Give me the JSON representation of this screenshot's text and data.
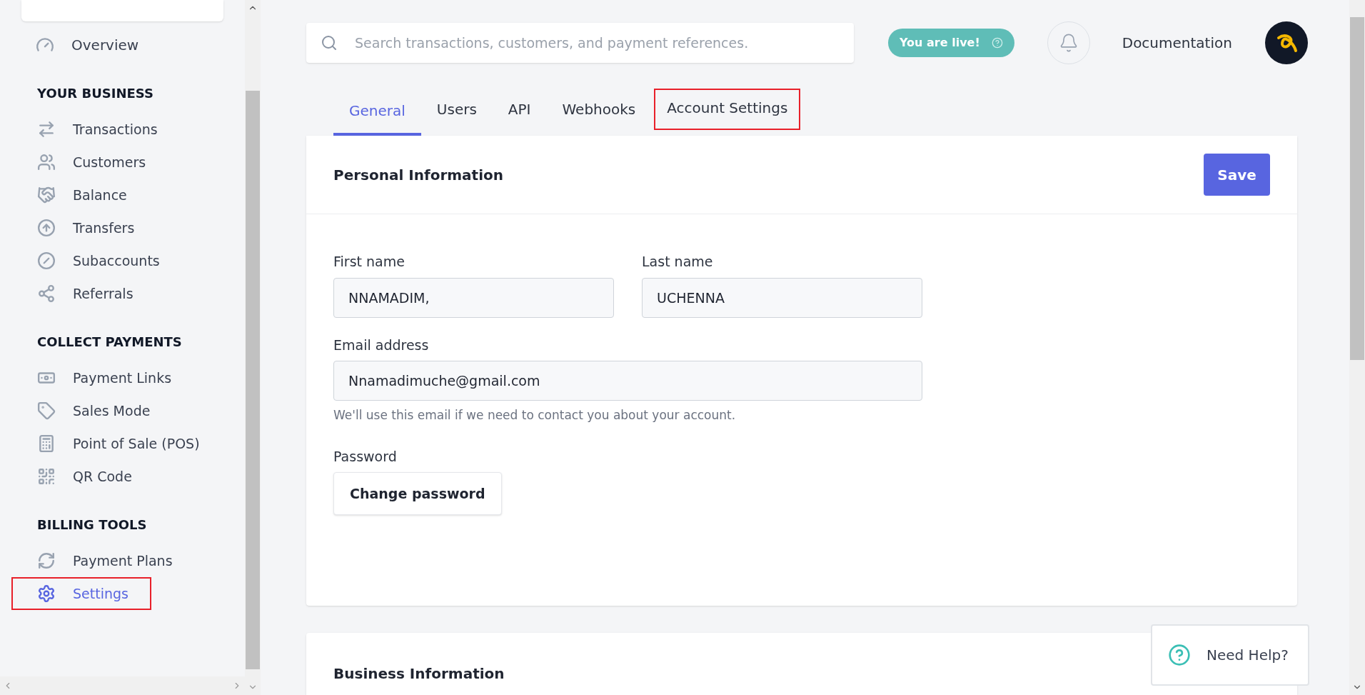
{
  "sidebar": {
    "top_item": {
      "label": "Overview",
      "selected": false
    },
    "sections": [
      {
        "title": "YOUR BUSINESS",
        "items": [
          {
            "label": "Transactions",
            "kind": "transactions",
            "selected": false,
            "highlighted": false
          },
          {
            "label": "Customers",
            "kind": "customers",
            "selected": false,
            "highlighted": false
          },
          {
            "label": "Balance",
            "kind": "balance",
            "selected": false,
            "highlighted": false
          },
          {
            "label": "Transfers",
            "kind": "transfers",
            "selected": false,
            "highlighted": false
          },
          {
            "label": "Subaccounts",
            "kind": "subaccounts",
            "selected": false,
            "highlighted": false
          },
          {
            "label": "Referrals",
            "kind": "referrals",
            "selected": false,
            "highlighted": false
          }
        ]
      },
      {
        "title": "COLLECT PAYMENTS",
        "items": [
          {
            "label": "Payment Links",
            "kind": "links",
            "selected": false,
            "highlighted": false
          },
          {
            "label": "Sales Mode",
            "kind": "tag",
            "selected": false,
            "highlighted": false
          },
          {
            "label": "Point of Sale (POS)",
            "kind": "pos",
            "selected": false,
            "highlighted": false
          },
          {
            "label": "QR Code",
            "kind": "qr",
            "selected": false,
            "highlighted": false
          }
        ]
      },
      {
        "title": "BILLING TOOLS",
        "items": [
          {
            "label": "Payment Plans",
            "kind": "plans",
            "selected": false,
            "highlighted": false
          },
          {
            "label": "Settings",
            "kind": "settings",
            "selected": true,
            "highlighted": true
          }
        ]
      }
    ]
  },
  "header": {
    "search": {
      "placeholder": "Search transactions, customers, and payment references."
    },
    "live_badge": "You are live!",
    "docs_link": "Documentation"
  },
  "tabs": [
    {
      "label": "General",
      "selected": true,
      "highlighted": false
    },
    {
      "label": "Users",
      "selected": false,
      "highlighted": false
    },
    {
      "label": "API",
      "selected": false,
      "highlighted": false
    },
    {
      "label": "Webhooks",
      "selected": false,
      "highlighted": false
    },
    {
      "label": "Account Settings",
      "selected": false,
      "highlighted": true
    }
  ],
  "personal_card": {
    "title": "Personal Information",
    "save": "Save",
    "first_name": {
      "label": "First name",
      "value": "NNAMADIM,"
    },
    "last_name": {
      "label": "Last name",
      "value": "UCHENNA"
    },
    "email": {
      "label": "Email address",
      "value": "Nnamadimuche@gmail.com",
      "hint": "We'll use this email if we need to contact you about your account."
    },
    "password": {
      "label": "Password",
      "button": "Change password"
    }
  },
  "business_card": {
    "title": "Business Information"
  },
  "help": {
    "label": "Need Help?"
  }
}
